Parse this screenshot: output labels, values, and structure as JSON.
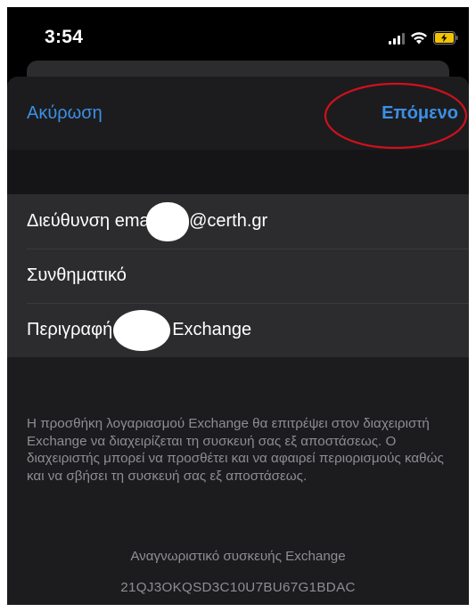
{
  "status_bar": {
    "time": "3:54",
    "icons": [
      "signal-icon",
      "wifi-icon",
      "battery-charging-icon"
    ],
    "battery_color": "#f2c500"
  },
  "nav": {
    "cancel_label": "Ακύρωση",
    "next_label": "Επόμενο",
    "accent_color": "#3c8fe6",
    "highlight_color": "#d0101c"
  },
  "form": {
    "email": {
      "label": "Διεύθυνση emai",
      "value_suffix": "s@certh.gr"
    },
    "password": {
      "label": "Συνθηματικό"
    },
    "description": {
      "label": "Περιγραφή",
      "value_suffix": "Exchange"
    }
  },
  "footer": {
    "notice": "Η προσθήκη λογαριασμού Exchange θα επιτρέψει στον διαχειριστή Exchange να διαχειρίζεται τη συσκευή σας εξ αποστάσεως. Ο διαχειριστής μπορεί να προσθέτει και να αφαιρεί περιορισμούς καθώς και να σβήσει τη συσκευή σας εξ αποστάσεως.",
    "device_id_label": "Αναγνωριστικό συσκευής Exchange",
    "device_id_value": "21QJ3OKQSD3C10U7BU67G1BDAC"
  }
}
